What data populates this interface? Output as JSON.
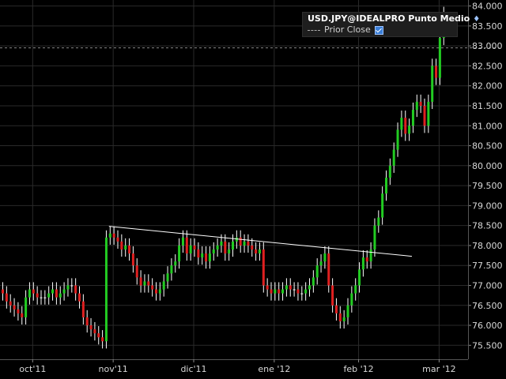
{
  "legend": {
    "title": "USD.JPY@IDEALPRO Punto Medio",
    "prior_close_label": "Prior Close"
  },
  "chart_data": {
    "type": "candlestick",
    "title": "USD.JPY@IDEALPRO Punto Medio",
    "y_ticks": [
      "84.000",
      "83.500",
      "83.000",
      "82.500",
      "82.000",
      "81.500",
      "81.000",
      "80.500",
      "80.000",
      "79.500",
      "79.000",
      "78.500",
      "78.000",
      "77.500",
      "77.000",
      "76.500",
      "76.000",
      "75.500"
    ],
    "ylim": [
      75.15,
      84.15
    ],
    "x_ticks": [
      "oct'11",
      "nov'11",
      "dic'11",
      "ene '12",
      "feb '12",
      "mar '12"
    ],
    "prior_close": 82.95,
    "trendline": {
      "start_close_index": 28,
      "end_close_index": 107,
      "start_value": 78.48,
      "end_value": 77.73
    },
    "colors": {
      "up": "#22cc22",
      "down": "#e02020",
      "neutral": "#ffffff",
      "trendline": "#ffffff",
      "grid": "#2a2a2a",
      "axis_text": "#d8d8d8"
    },
    "closes": [
      76.8,
      76.6,
      76.5,
      76.4,
      76.3,
      76.2,
      76.7,
      76.9,
      76.8,
      76.7,
      76.7,
      76.7,
      76.8,
      76.9,
      76.7,
      76.8,
      76.9,
      77.0,
      77.0,
      76.8,
      76.6,
      76.2,
      76.0,
      75.9,
      75.8,
      75.7,
      75.6,
      78.2,
      78.3,
      78.2,
      78.1,
      77.9,
      78.0,
      77.8,
      77.5,
      77.2,
      77.0,
      77.1,
      77.0,
      76.9,
      76.8,
      76.9,
      77.1,
      77.3,
      77.5,
      77.6,
      78.0,
      78.2,
      77.8,
      78.0,
      77.9,
      77.7,
      77.8,
      77.6,
      77.8,
      77.9,
      78.0,
      78.1,
      77.8,
      77.9,
      78.1,
      78.2,
      78.0,
      78.1,
      78.0,
      77.9,
      77.8,
      77.9,
      77.0,
      76.9,
      76.8,
      76.9,
      76.8,
      76.9,
      77.0,
      76.9,
      76.9,
      76.8,
      76.8,
      76.9,
      77.0,
      77.2,
      77.5,
      77.6,
      77.8,
      77.0,
      76.5,
      76.3,
      76.1,
      76.2,
      76.5,
      76.8,
      77.0,
      77.4,
      77.7,
      77.6,
      77.9,
      78.5,
      78.7,
      79.3,
      79.7,
      80.0,
      80.4,
      80.9,
      81.2,
      80.8,
      81.0,
      81.4,
      81.6,
      81.5,
      81.0,
      81.6,
      82.5,
      82.2,
      83.2,
      83.8
    ],
    "y_label": "",
    "x_label": ""
  }
}
